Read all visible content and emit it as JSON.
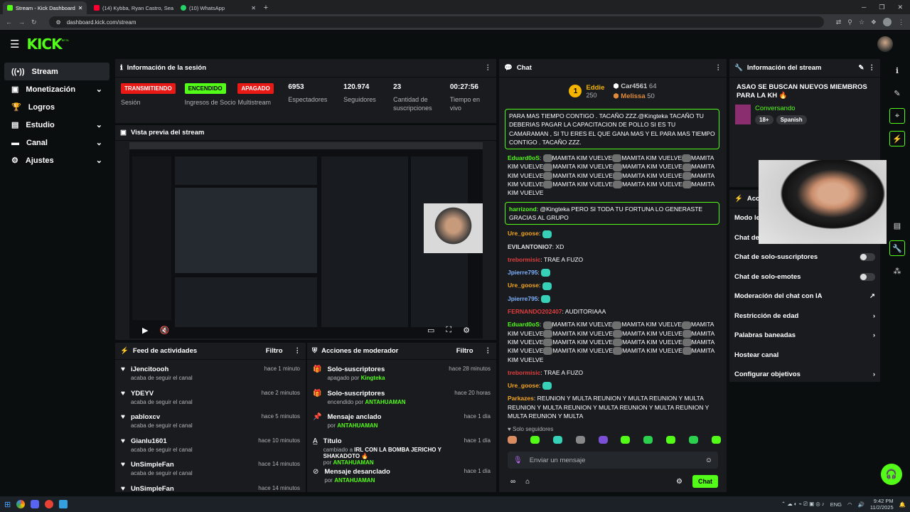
{
  "browser": {
    "tabs": [
      {
        "title": "Stream - Kick Dashboard",
        "color": "#53fc18"
      },
      {
        "title": "(14) Kybba, Ryan Castro, Sean P",
        "color": "#ff0033"
      },
      {
        "title": "(10) WhatsApp",
        "color": "#25d366"
      }
    ],
    "url": "dashboard.kick.com/stream",
    "new_tab": "+"
  },
  "brand": {
    "logo": "KICK",
    "beta": "BETA",
    "accent": "#53fc18"
  },
  "sidebar": {
    "items": [
      {
        "label": "Stream",
        "icon": "broadcast-icon"
      },
      {
        "label": "Monetización",
        "icon": "wallet-icon"
      },
      {
        "label": "Logros",
        "icon": "trophy-icon"
      },
      {
        "label": "Estudio",
        "icon": "studio-icon"
      },
      {
        "label": "Canal",
        "icon": "channel-icon"
      },
      {
        "label": "Ajustes",
        "icon": "gear-icon"
      }
    ]
  },
  "session": {
    "title": "Información de la sesión",
    "cols": [
      {
        "badge": "TRANSMITIENDO",
        "label": "Sesión"
      },
      {
        "badge": "ENCENDIDO",
        "label": "Ingresos de Socio"
      },
      {
        "badge": "APAGADO",
        "label": "Multistream"
      },
      {
        "value": "6953",
        "label": "Espectadores"
      },
      {
        "value": "120.974",
        "label": "Seguidores"
      },
      {
        "value": "23",
        "label": "Cantidad de suscripciones"
      },
      {
        "value": "00:27:56",
        "label": "Tiempo en vivo"
      }
    ]
  },
  "preview": {
    "title": "Vista previa del stream"
  },
  "feed": {
    "title": "Feed de actividades",
    "filter": "Filtro",
    "rows": [
      {
        "name": "iJencitoooh",
        "sub": "acaba de seguir el canal",
        "time": "hace 1 minuto"
      },
      {
        "name": "YDEYV",
        "sub": "acaba de seguir el canal",
        "time": "hace 2 minutos"
      },
      {
        "name": "pabloxcv",
        "sub": "acaba de seguir el canal",
        "time": "hace 5 minutos"
      },
      {
        "name": "Gianlu1601",
        "sub": "acaba de seguir el canal",
        "time": "hace 10 minutos"
      },
      {
        "name": "UnSimpleFan",
        "sub": "acaba de seguir el canal",
        "time": "hace 14 minutos"
      },
      {
        "name": "UnSimpleFan",
        "sub": "",
        "time": "hace 14 minutos"
      }
    ]
  },
  "modactions": {
    "title": "Acciones de moderador",
    "filter": "Filtro",
    "rows": [
      {
        "name": "Solo-suscriptores",
        "pre": "apagado por",
        "who": "Kingteka",
        "time": "hace 28 minutos"
      },
      {
        "name": "Solo-suscriptores",
        "pre": "encendido por",
        "who": "ANTAHUAMAN",
        "time": "hace 20 horas"
      },
      {
        "name": "Mensaje anclado",
        "pre": "por",
        "who": "ANTAHUAMAN",
        "time": "hace 1 día"
      },
      {
        "name": "Título",
        "pre": "cambiado a",
        "who2": "IRL CON LA BOMBA JERICHO Y SHAKADOTO 🔥",
        "pre2": "por",
        "who": "ANTAHUAMAN",
        "time": "hace 1 día"
      },
      {
        "name": "Mensaje desanclado",
        "pre": "por",
        "who": "ANTAHUAMAN",
        "time": "hace 1 día"
      }
    ]
  },
  "chat": {
    "title": "Chat",
    "leaders": [
      {
        "rank": "1",
        "name": "Eddie",
        "score": "250"
      },
      {
        "name": "Car4561",
        "score": "64"
      },
      {
        "name": "Melissa",
        "score": "50"
      }
    ],
    "pinned": "PARA MAS TIEMPO CONTIGO . TACAÑO ZZZ.@Kingteka TACAÑO TU DEBERIAS PAGAR LA CAPACITACION DE POLLO SI ES TU CAMARAMAN , SI TU ERES EL QUE GANA MAS Y EL PARA MAS TIEMPO CONTIGO . TACAÑO ZZZ.",
    "messages": [
      {
        "user": "Eduard0oS",
        "color": "#53fc18",
        "text": "MAMITA KIM VUELVE",
        "emotes": 12
      },
      {
        "user": "harrizond",
        "color": "#53fc18",
        "text": "@Kingteka PERO SI TODA TU FORTUNA LO GENERASTE GRACIAS AL GRUPO",
        "highlight": true
      },
      {
        "user": "Ure_goose",
        "color": "#f5a623",
        "text": ""
      },
      {
        "user": "EVILANTONIO7",
        "color": "#e0e0e0",
        "text": "XD"
      },
      {
        "user": "trebormisic",
        "color": "#e03e3e",
        "text": "TRAE A FUZO"
      },
      {
        "user": "Jpierre795",
        "color": "#7fb2ff",
        "text": ""
      },
      {
        "user": "Ure_goose",
        "color": "#f5a623",
        "text": ""
      },
      {
        "user": "Jpierre795",
        "color": "#7fb2ff",
        "text": ""
      },
      {
        "user": "FERNANDO202407",
        "color": "#e03e3e",
        "text": "AUDITORIAAA"
      },
      {
        "user": "Eduard0oS",
        "color": "#53fc18",
        "text": "MAMITA KIM VUELVE",
        "emotes": 12
      },
      {
        "user": "trebormisic",
        "color": "#e03e3e",
        "text": "TRAE A FUZO"
      },
      {
        "user": "Ure_goose",
        "color": "#f5a623",
        "text": ""
      },
      {
        "user": "Parkazes",
        "color": "#f5a623",
        "text": "REUNION Y MULTA REUNION Y MULTA REUNION Y MULTA REUNION Y MULTA REUNION Y MULTA REUNION Y MULTA REUNION Y MULTA REUNION Y MULTA"
      }
    ],
    "followers_only": "Solo seguidores",
    "input_placeholder": "Enviar un mensaje",
    "send": "Chat"
  },
  "streaminfo": {
    "title": "Información del stream",
    "name": "ASAO SE BUSCAN NUEVOS MIEMBROS PARA LA KH 🔥",
    "category": "Conversando",
    "tags": [
      "18+",
      "Spanish"
    ]
  },
  "actions": {
    "title": "Acciones",
    "rows": [
      {
        "label": "Modo le"
      },
      {
        "label": "Chat de"
      },
      {
        "label": "Chat de solo-suscriptores",
        "toggle": true
      },
      {
        "label": "Chat de solo-emotes",
        "toggle": true
      },
      {
        "label": "Moderación del chat con IA",
        "ext": true
      },
      {
        "label": "Restricción de edad",
        "chev": true
      },
      {
        "label": "Palabras baneadas",
        "chev": true
      },
      {
        "label": "Hostear canal"
      },
      {
        "label": "Configurar objetivos",
        "chev": true
      }
    ]
  },
  "taskbar": {
    "lang": "ENG",
    "time": "9:42 PM",
    "date": "11/2/2025"
  }
}
